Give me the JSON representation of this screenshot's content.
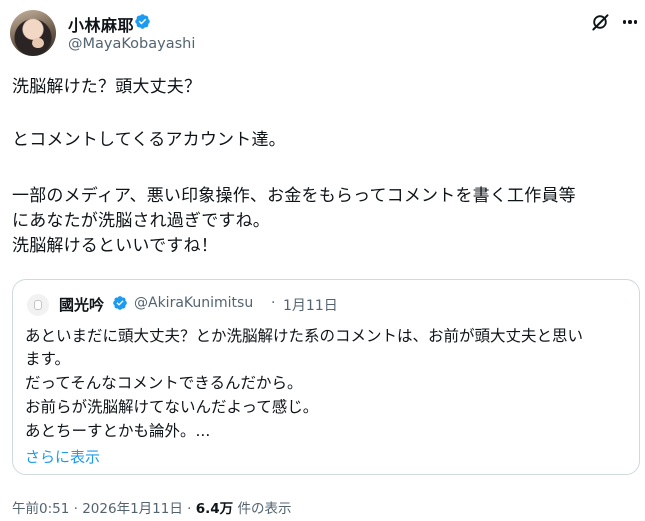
{
  "author": {
    "name": "小林麻耶",
    "handle": "@MayaKobayashi"
  },
  "tweet": {
    "lines": [
      "洗脳解けた？頭大丈夫？",
      "とコメントしてくるアカウント達。",
      "一部のメディア、悪い印象操作、お金をもらってコメントを書く工作員等",
      "にあなたが洗脳され過ぎですね。",
      "洗脳解けるといいですね！"
    ]
  },
  "quote": {
    "name": "國光吟",
    "handle": "@AkiraKunimitsu",
    "separator": "·",
    "date": "1月11日",
    "lines": [
      "あといまだに頭大丈夫？とか洗脳解けた系のコメントは、お前が頭大丈夫と思い",
      "ます。",
      "だってそんなコメントできるんだから。",
      "お前らが洗脳解けてないんだよって感じ。",
      "あとちーすとかも論外。..."
    ],
    "show_more": "さらに表示"
  },
  "footer": {
    "time": "午前0:51",
    "separator1": "·",
    "date": "2026年1月11日",
    "separator2": "·",
    "views_count": "6.4万",
    "views_label": "件の表示"
  },
  "colors": {
    "verified": "#1d9bf0",
    "link": "#1d9bf0",
    "secondary_text": "#536471",
    "border": "#cfd9de"
  },
  "icons": {
    "verified": "verified-badge-icon",
    "grok": "grok-icon",
    "more": "more-options-icon"
  }
}
